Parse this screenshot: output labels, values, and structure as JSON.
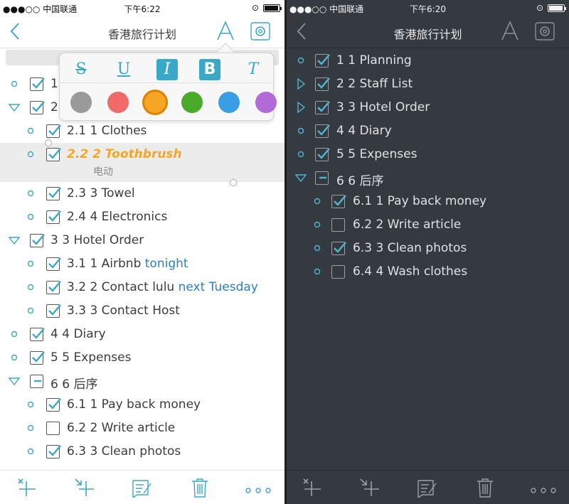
{
  "status_light": {
    "carrier": "●●●○○ 中国联通",
    "time": "下午6:22"
  },
  "status_dark": {
    "carrier": "●●●○○ 中国联通",
    "time": "下午6:20"
  },
  "nav": {
    "title": "香港旅行计划"
  },
  "format_popover": {
    "buttons": [
      {
        "label": "S",
        "name": "strikethrough-button",
        "active": false
      },
      {
        "label": "U",
        "name": "underline-button",
        "active": false
      },
      {
        "label": "I",
        "name": "italic-button",
        "active": true
      },
      {
        "label": "B",
        "name": "bold-button",
        "active": true
      },
      {
        "label": "T",
        "name": "clear-format-button",
        "active": false
      }
    ],
    "colors": [
      "#9a9a9a",
      "#f06a6a",
      "#f5a623",
      "#4aaa2a",
      "#3a9ee4",
      "#b26ad6"
    ],
    "selected_color": "#f5a623"
  },
  "light_list": [
    {
      "text": "1",
      "checked": true,
      "level": 0,
      "toggle": "circle"
    },
    {
      "text": "2",
      "checked": true,
      "level": 0,
      "toggle": "open"
    },
    {
      "text": "2.1  1  Clothes",
      "checked": true,
      "level": 1,
      "toggle": "circle"
    },
    {
      "text": "2.2  2  Toothbrush",
      "checked": true,
      "level": 1,
      "toggle": "circle",
      "note": "电动"
    },
    {
      "text": "2.3  3  Towel",
      "checked": true,
      "level": 1,
      "toggle": "circle"
    },
    {
      "text": "2.4  4  Electronics",
      "checked": true,
      "level": 1,
      "toggle": "circle"
    },
    {
      "text": "3  3  Hotel Order",
      "checked": true,
      "level": 0,
      "toggle": "open"
    },
    {
      "text": "3.1  1  Airbnb ",
      "link": "tonight",
      "checked": true,
      "level": 1,
      "toggle": "circle"
    },
    {
      "text": "3.2  2  Contact lulu ",
      "link": "next Tuesday",
      "checked": true,
      "level": 1,
      "toggle": "circle"
    },
    {
      "text": "3.3  3  Contact Host",
      "checked": true,
      "level": 1,
      "toggle": "circle"
    },
    {
      "text": "4  4  Diary",
      "checked": true,
      "level": 0,
      "toggle": "circle"
    },
    {
      "text": "5  5  Expenses",
      "checked": true,
      "level": 0,
      "toggle": "circle"
    },
    {
      "text": "6  6  后序",
      "checked": "partial",
      "level": 0,
      "toggle": "open"
    },
    {
      "text": "6.1  1  Pay back money",
      "checked": true,
      "level": 1,
      "toggle": "circle"
    },
    {
      "text": "6.2  2  Write article",
      "checked": false,
      "level": 1,
      "toggle": "circle"
    },
    {
      "text": "6.3  3  Clean photos",
      "checked": true,
      "level": 1,
      "toggle": "circle"
    }
  ],
  "dark_list": [
    {
      "text": "1  1  Planning",
      "checked": true,
      "level": 0,
      "toggle": "circle"
    },
    {
      "text": "2  2  Staff List",
      "checked": true,
      "level": 0,
      "toggle": "closed"
    },
    {
      "text": "3  3  Hotel Order",
      "checked": true,
      "level": 0,
      "toggle": "closed"
    },
    {
      "text": "4  4  Diary",
      "checked": true,
      "level": 0,
      "toggle": "circle"
    },
    {
      "text": "5  5  Expenses",
      "checked": true,
      "level": 0,
      "toggle": "circle"
    },
    {
      "text": "6  6  后序",
      "checked": "partial",
      "level": 0,
      "toggle": "open"
    },
    {
      "text": "6.1  1  Pay back money",
      "checked": true,
      "level": 1,
      "toggle": "circle"
    },
    {
      "text": "6.2  2  Write article",
      "checked": false,
      "level": 1,
      "toggle": "circle"
    },
    {
      "text": "6.3  3  Clean photos",
      "checked": true,
      "level": 1,
      "toggle": "circle"
    },
    {
      "text": "6.4  4  Wash clothes",
      "checked": false,
      "level": 1,
      "toggle": "circle"
    }
  ],
  "toolbar": {
    "items": [
      "add-sibling-icon",
      "add-child-icon",
      "edit-note-icon",
      "trash-icon",
      "more-icon"
    ]
  },
  "colors": {
    "accent": "#3aa8c9",
    "highlight": "#f5a623",
    "link": "#2a7fc7",
    "dark_bg": "#353a40"
  }
}
